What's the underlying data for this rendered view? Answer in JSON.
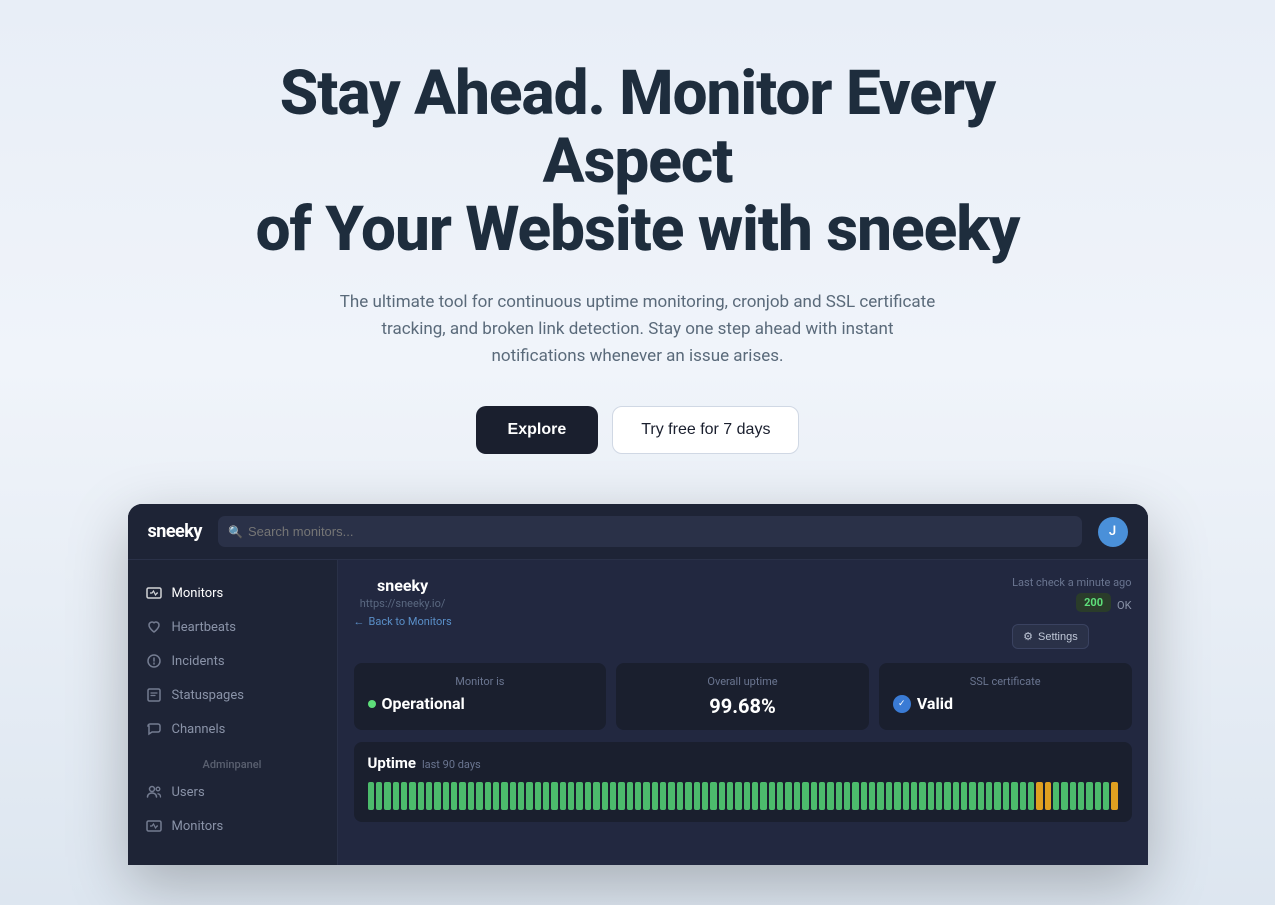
{
  "hero": {
    "title_line1": "Stay Ahead. Monitor Every Aspect",
    "title_line2": "of Your Website with sneeky",
    "subtitle": "The ultimate tool for continuous uptime monitoring, cronjob and SSL certificate tracking, and broken link detection. Stay one step ahead with instant notifications whenever an issue arises.",
    "btn_explore": "Explore",
    "btn_try": "Try free for 7 days"
  },
  "dashboard": {
    "logo": "sneeky",
    "search_placeholder": "Search monitors...",
    "avatar_letter": "J",
    "sidebar": {
      "items": [
        {
          "label": "Monitors",
          "icon": "monitors"
        },
        {
          "label": "Heartbeats",
          "icon": "heartbeats"
        },
        {
          "label": "Incidents",
          "icon": "incidents"
        },
        {
          "label": "Statuspages",
          "icon": "statuspages"
        },
        {
          "label": "Channels",
          "icon": "channels"
        }
      ],
      "admin_section": "Adminpanel",
      "admin_items": [
        {
          "label": "Users",
          "icon": "users"
        },
        {
          "label": "Monitors",
          "icon": "monitors2"
        }
      ]
    },
    "monitor": {
      "name": "sneeky",
      "url": "https://sneeky.io/",
      "back_label": "Back to Monitors",
      "last_check": "Last check a minute ago",
      "status_code": "200",
      "status_text": "OK",
      "settings_label": "Settings",
      "stat_operational_label": "Monitor is",
      "stat_operational_value": "Operational",
      "stat_uptime_label": "Overall uptime",
      "stat_uptime_value": "99.68%",
      "stat_ssl_label": "SSL certificate",
      "stat_ssl_value": "Valid",
      "uptime_title": "Uptime",
      "uptime_period": "last 90 days"
    }
  }
}
